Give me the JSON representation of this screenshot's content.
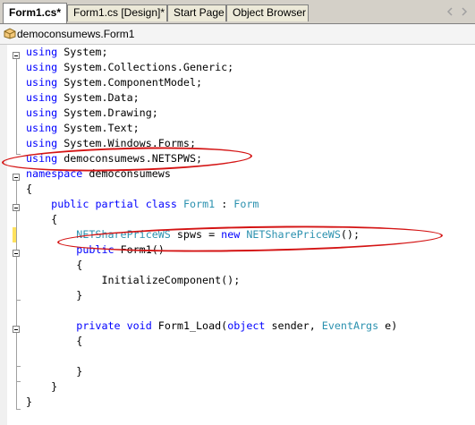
{
  "tabs": [
    {
      "label": "Form1.cs*"
    },
    {
      "label": "Form1.cs [Design]*"
    },
    {
      "label": "Start Page"
    },
    {
      "label": "Object Browser"
    }
  ],
  "breadcrumb": {
    "label": "democonsumews.Form1"
  },
  "code_lines": [
    {
      "tokens": [
        {
          "t": "using",
          "k": "kw"
        },
        {
          "t": " System;"
        }
      ]
    },
    {
      "tokens": [
        {
          "t": "using",
          "k": "kw"
        },
        {
          "t": " System.Collections.Generic;"
        }
      ]
    },
    {
      "tokens": [
        {
          "t": "using",
          "k": "kw"
        },
        {
          "t": " System.ComponentModel;"
        }
      ]
    },
    {
      "tokens": [
        {
          "t": "using",
          "k": "kw"
        },
        {
          "t": " System.Data;"
        }
      ]
    },
    {
      "tokens": [
        {
          "t": "using",
          "k": "kw"
        },
        {
          "t": " System.Drawing;"
        }
      ]
    },
    {
      "tokens": [
        {
          "t": "using",
          "k": "kw"
        },
        {
          "t": " System.Text;"
        }
      ]
    },
    {
      "tokens": [
        {
          "t": "using",
          "k": "kw"
        },
        {
          "t": " System.Windows.Forms;"
        }
      ]
    },
    {
      "tokens": [
        {
          "t": "using",
          "k": "kw"
        },
        {
          "t": " democonsumews.NETSPWS;"
        }
      ]
    },
    {
      "tokens": [
        {
          "t": "namespace",
          "k": "kw"
        },
        {
          "t": " democonsumews"
        }
      ]
    },
    {
      "tokens": [
        {
          "t": "{"
        }
      ]
    },
    {
      "tokens": [
        {
          "t": "    "
        },
        {
          "t": "public",
          "k": "kw"
        },
        {
          "t": " "
        },
        {
          "t": "partial",
          "k": "kw"
        },
        {
          "t": " "
        },
        {
          "t": "class",
          "k": "kw"
        },
        {
          "t": " "
        },
        {
          "t": "Form1",
          "k": "ty"
        },
        {
          "t": " : "
        },
        {
          "t": "Form",
          "k": "ty"
        }
      ]
    },
    {
      "tokens": [
        {
          "t": "    {"
        }
      ]
    },
    {
      "tokens": [
        {
          "t": "        "
        },
        {
          "t": "NETSharePriceWS",
          "k": "ty"
        },
        {
          "t": " spws = "
        },
        {
          "t": "new",
          "k": "kw"
        },
        {
          "t": " "
        },
        {
          "t": "NETSharePriceWS",
          "k": "ty"
        },
        {
          "t": "();"
        }
      ]
    },
    {
      "tokens": [
        {
          "t": "        "
        },
        {
          "t": "public",
          "k": "kw"
        },
        {
          "t": " Form1()"
        }
      ]
    },
    {
      "tokens": [
        {
          "t": "        {"
        }
      ]
    },
    {
      "tokens": [
        {
          "t": "            InitializeComponent();"
        }
      ]
    },
    {
      "tokens": [
        {
          "t": "        }"
        }
      ]
    },
    {
      "tokens": [
        {
          "t": ""
        }
      ]
    },
    {
      "tokens": [
        {
          "t": "        "
        },
        {
          "t": "private",
          "k": "kw"
        },
        {
          "t": " "
        },
        {
          "t": "void",
          "k": "kw"
        },
        {
          "t": " Form1_Load("
        },
        {
          "t": "object",
          "k": "kw"
        },
        {
          "t": " sender, "
        },
        {
          "t": "EventArgs",
          "k": "ty"
        },
        {
          "t": " e)"
        }
      ]
    },
    {
      "tokens": [
        {
          "t": "        {"
        }
      ]
    },
    {
      "tokens": [
        {
          "t": ""
        }
      ]
    },
    {
      "tokens": [
        {
          "t": "        }"
        }
      ]
    },
    {
      "tokens": [
        {
          "t": "    }"
        }
      ]
    },
    {
      "tokens": [
        {
          "t": "}"
        }
      ]
    }
  ],
  "colors": {
    "keyword": "#0000ff",
    "type": "#2b91af",
    "annotation": "#d41414",
    "changed_marker": "#ffe25e"
  },
  "icons": [
    "chevron-left-icon",
    "chevron-right-icon",
    "class-icon",
    "collapse-box-icon"
  ]
}
